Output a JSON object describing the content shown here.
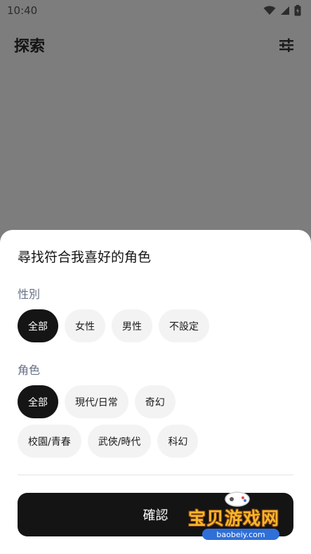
{
  "status_bar": {
    "time": "10:40"
  },
  "header": {
    "title": "探索"
  },
  "sheet": {
    "title": "尋找符合我喜好的角色",
    "gender": {
      "label": "性別",
      "options": [
        "全部",
        "女性",
        "男性",
        "不設定"
      ],
      "selected": "全部"
    },
    "role": {
      "label": "角色",
      "options_row1": [
        "全部",
        "現代/日常",
        "奇幻"
      ],
      "options_row2": [
        "校園/青春",
        "武俠/時代",
        "科幻"
      ],
      "selected": "全部"
    },
    "confirm_label": "確認"
  },
  "watermark": {
    "text": "宝贝游戏网",
    "url": "baobeiy.com"
  },
  "icons": {
    "filter": "sliders-icon",
    "wifi": "wifi-icon",
    "signal": "signal-icon",
    "battery": "battery-icon"
  }
}
